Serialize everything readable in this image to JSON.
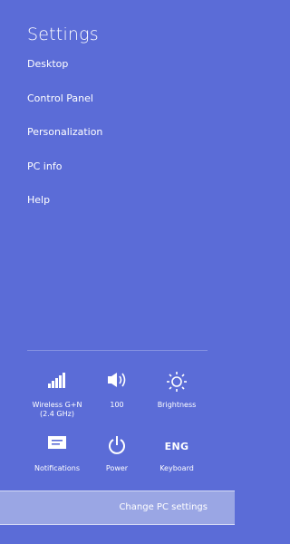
{
  "charm": {
    "title": "Settings",
    "menu": [
      "Desktop",
      "Control Panel",
      "Personalization",
      "PC info",
      "Help"
    ]
  },
  "quick": {
    "network": {
      "label1": "Wireless G+N",
      "label2": "(2.4 GHz)",
      "icon": "wifi-signal-icon"
    },
    "volume": {
      "label": "100",
      "icon": "speaker-icon"
    },
    "brightness": {
      "label": "Brightness",
      "icon": "sun-icon"
    },
    "notifications": {
      "label": "Notifications",
      "icon": "notifications-icon"
    },
    "power": {
      "label": "Power",
      "icon": "power-icon"
    },
    "keyboard": {
      "label": "Keyboard",
      "code": "ENG"
    }
  },
  "footer": {
    "change_label": "Change PC settings"
  },
  "colors": {
    "background": "#5b6cd7",
    "footer": "#9aa6e4"
  }
}
